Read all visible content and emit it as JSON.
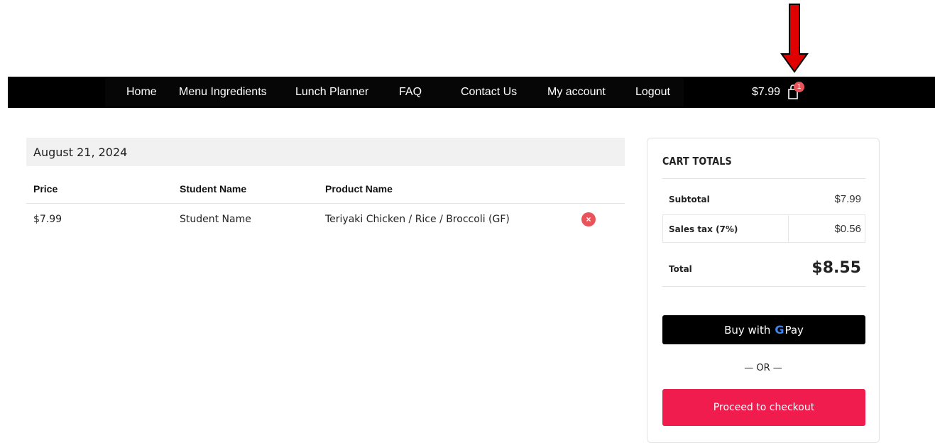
{
  "nav": {
    "links": [
      "Home",
      "Menu Ingredients",
      "Lunch Planner",
      "FAQ",
      "Contact Us",
      "My account",
      "Logout"
    ],
    "cart_total": "$7.99",
    "cart_count": "1"
  },
  "cart": {
    "date": "August 21, 2024",
    "columns": [
      "Price",
      "Student Name",
      "Product Name"
    ],
    "rows": [
      {
        "price": "$7.99",
        "student": "Student Name",
        "product": "Teriyaki Chicken / Rice / Broccoli (GF)",
        "remove_icon": "×"
      }
    ]
  },
  "totals": {
    "title": "CART TOTALS",
    "subtotal_label": "Subtotal",
    "subtotal_value": "$7.99",
    "tax_label": "Sales tax (7%)",
    "tax_value": "$0.56",
    "total_label": "Total",
    "total_value": "$8.55",
    "gpay_prefix": "Buy with",
    "gpay_g": "G",
    "gpay_pay": "Pay",
    "or_text": "— OR —",
    "checkout_label": "Proceed to checkout"
  },
  "colors": {
    "nav_bg": "#000000",
    "badge": "#e9545b",
    "checkout": "#f01c4e",
    "annotation_arrow": "#e00000"
  },
  "icons": {
    "cart": "shopping-bag-icon",
    "remove": "remove-icon",
    "annotation": "red-arrow-down-icon"
  }
}
